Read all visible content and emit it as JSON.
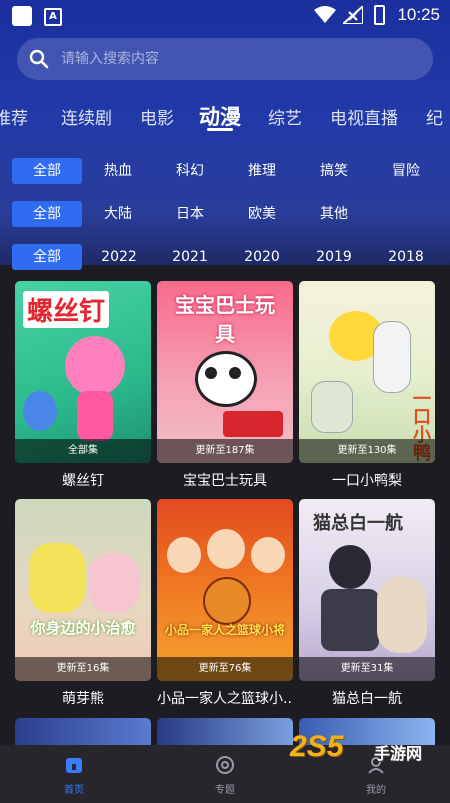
{
  "status_bar": {
    "time": "10:25",
    "a_label": "A"
  },
  "search": {
    "placeholder": "请输入搜索内容"
  },
  "tabs": [
    {
      "label": "推荐"
    },
    {
      "label": "连续剧"
    },
    {
      "label": "电影"
    },
    {
      "label": "动漫"
    },
    {
      "label": "综艺"
    },
    {
      "label": "电视直播"
    },
    {
      "label": "纪"
    }
  ],
  "active_tab": "动漫",
  "filters": {
    "genre": [
      "全部",
      "热血",
      "科幻",
      "推理",
      "搞笑",
      "冒险"
    ],
    "region": [
      "全部",
      "大陆",
      "日本",
      "欧美",
      "其他"
    ],
    "year": [
      "全部",
      "2022",
      "2021",
      "2020",
      "2019",
      "2018"
    ]
  },
  "cards": [
    {
      "title": "螺丝钉",
      "episode": "全部集",
      "poster_text": "螺丝钉"
    },
    {
      "title": "宝宝巴士玩具",
      "episode": "更新至187集",
      "poster_text": "宝宝巴士玩具"
    },
    {
      "title": "一口小鸭梨",
      "episode": "更新至130集",
      "poster_text": "一口小鸭"
    },
    {
      "title": "萌芽熊",
      "episode": "更新至16集",
      "poster_text": "你身边的小治愈"
    },
    {
      "title": "小品一家人之篮球小...",
      "episode": "更新至76集",
      "poster_text": "小品一家人之篮球小将"
    },
    {
      "title": "猫总白一航",
      "episode": "更新至31集",
      "poster_text": "猫总白一航"
    }
  ],
  "bottom_nav": [
    {
      "label": "首页",
      "icon": "home-icon"
    },
    {
      "label": "专题",
      "icon": "topic-icon"
    },
    {
      "label": "我的",
      "icon": "profile-icon"
    }
  ],
  "watermark": {
    "text": "2S5",
    "subtext": "手游网"
  },
  "colors": {
    "accent": "#2f6cf2",
    "header": "#223aa8",
    "background": "#1c1c22"
  }
}
